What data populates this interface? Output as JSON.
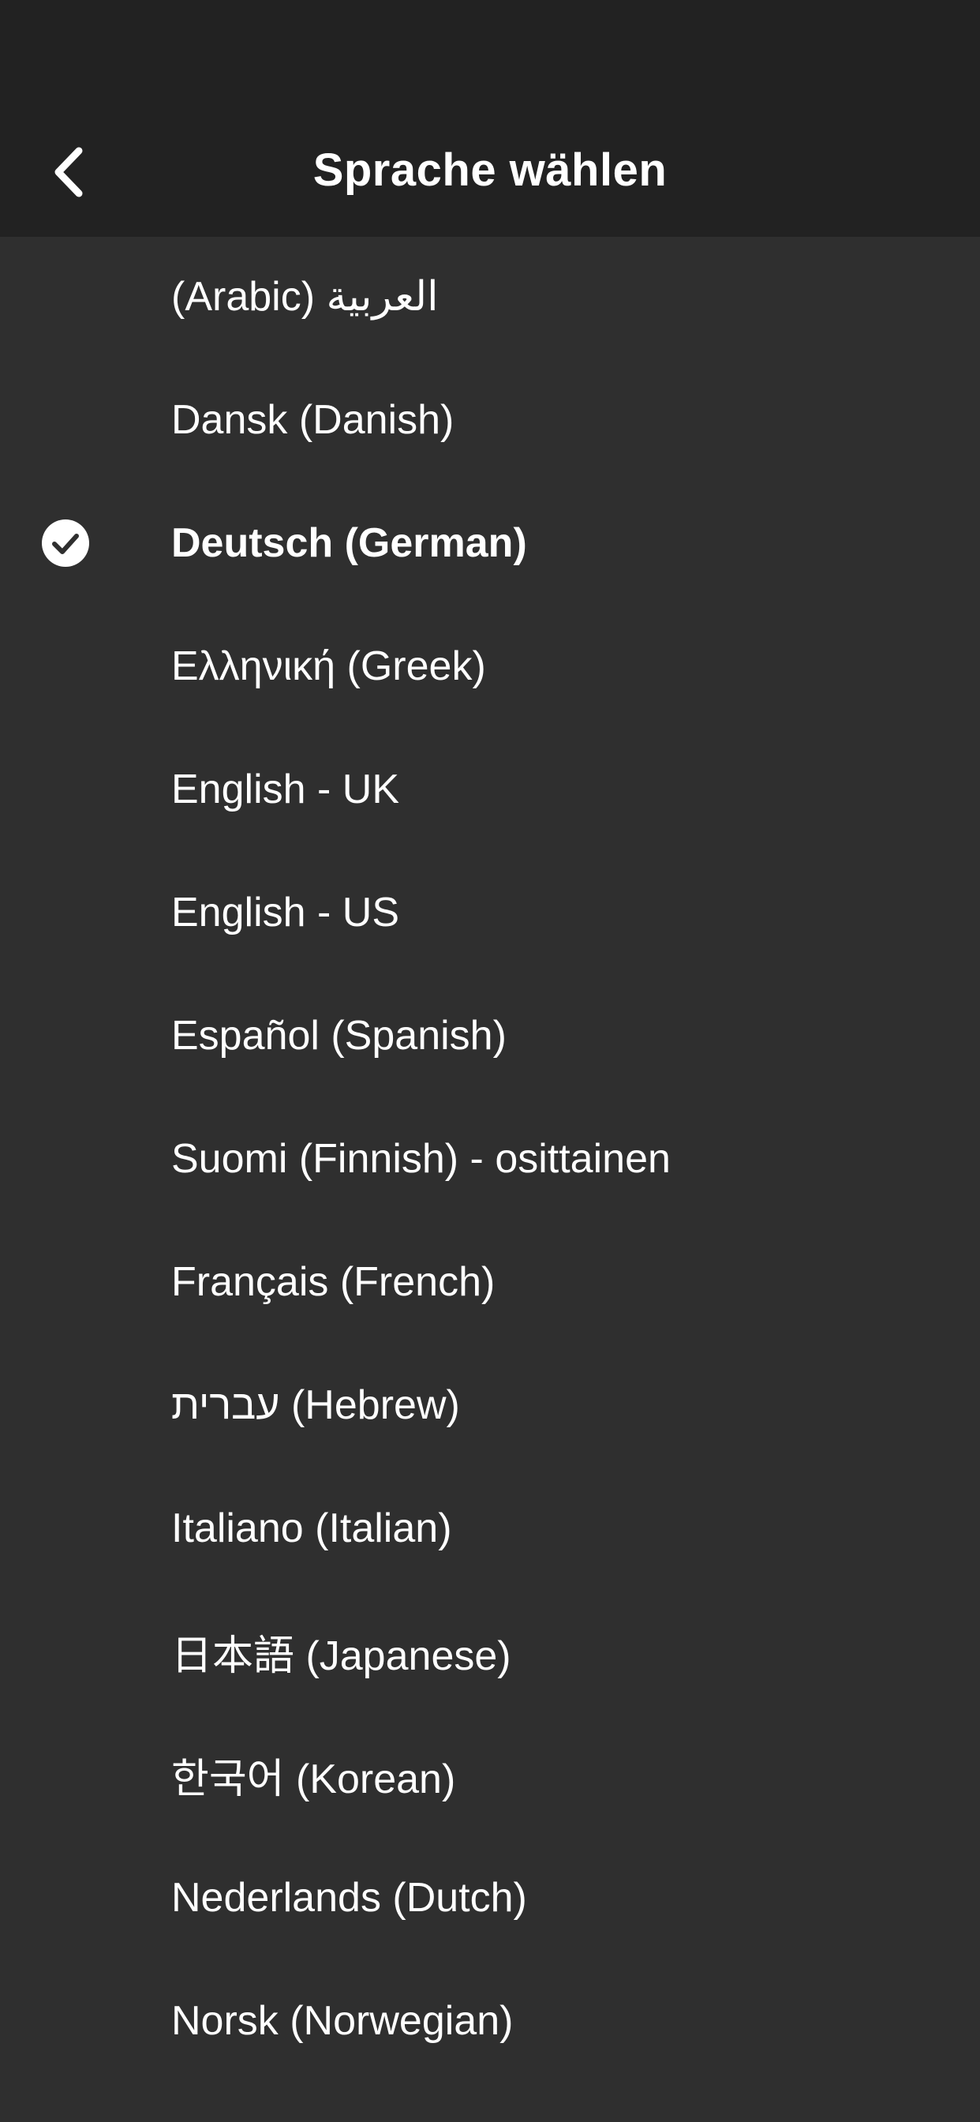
{
  "header": {
    "title": "Sprache wählen",
    "back_icon": "chevron-left-icon"
  },
  "languages": [
    {
      "label": "(Arabic) العربية",
      "selected": false
    },
    {
      "label": "Dansk (Danish)",
      "selected": false
    },
    {
      "label": "Deutsch (German)",
      "selected": true
    },
    {
      "label": "Ελληνική (Greek)",
      "selected": false
    },
    {
      "label": "English - UK",
      "selected": false
    },
    {
      "label": "English - US",
      "selected": false
    },
    {
      "label": "Español (Spanish)",
      "selected": false
    },
    {
      "label": "Suomi (Finnish) - osittainen",
      "selected": false
    },
    {
      "label": "Français (French)",
      "selected": false
    },
    {
      "label": "עברית (Hebrew)",
      "selected": false
    },
    {
      "label": "Italiano (Italian)",
      "selected": false
    },
    {
      "label": "日本語 (Japanese)",
      "selected": false
    },
    {
      "label": "한국어 (Korean)",
      "selected": false
    },
    {
      "label": "Nederlands (Dutch)",
      "selected": false
    },
    {
      "label": "Norsk (Norwegian)",
      "selected": false
    }
  ],
  "selected_icon": "checkmark-circle-icon",
  "colors": {
    "header_background": "#222222",
    "list_background": "#2f2f2f",
    "text": "#ffffff"
  }
}
